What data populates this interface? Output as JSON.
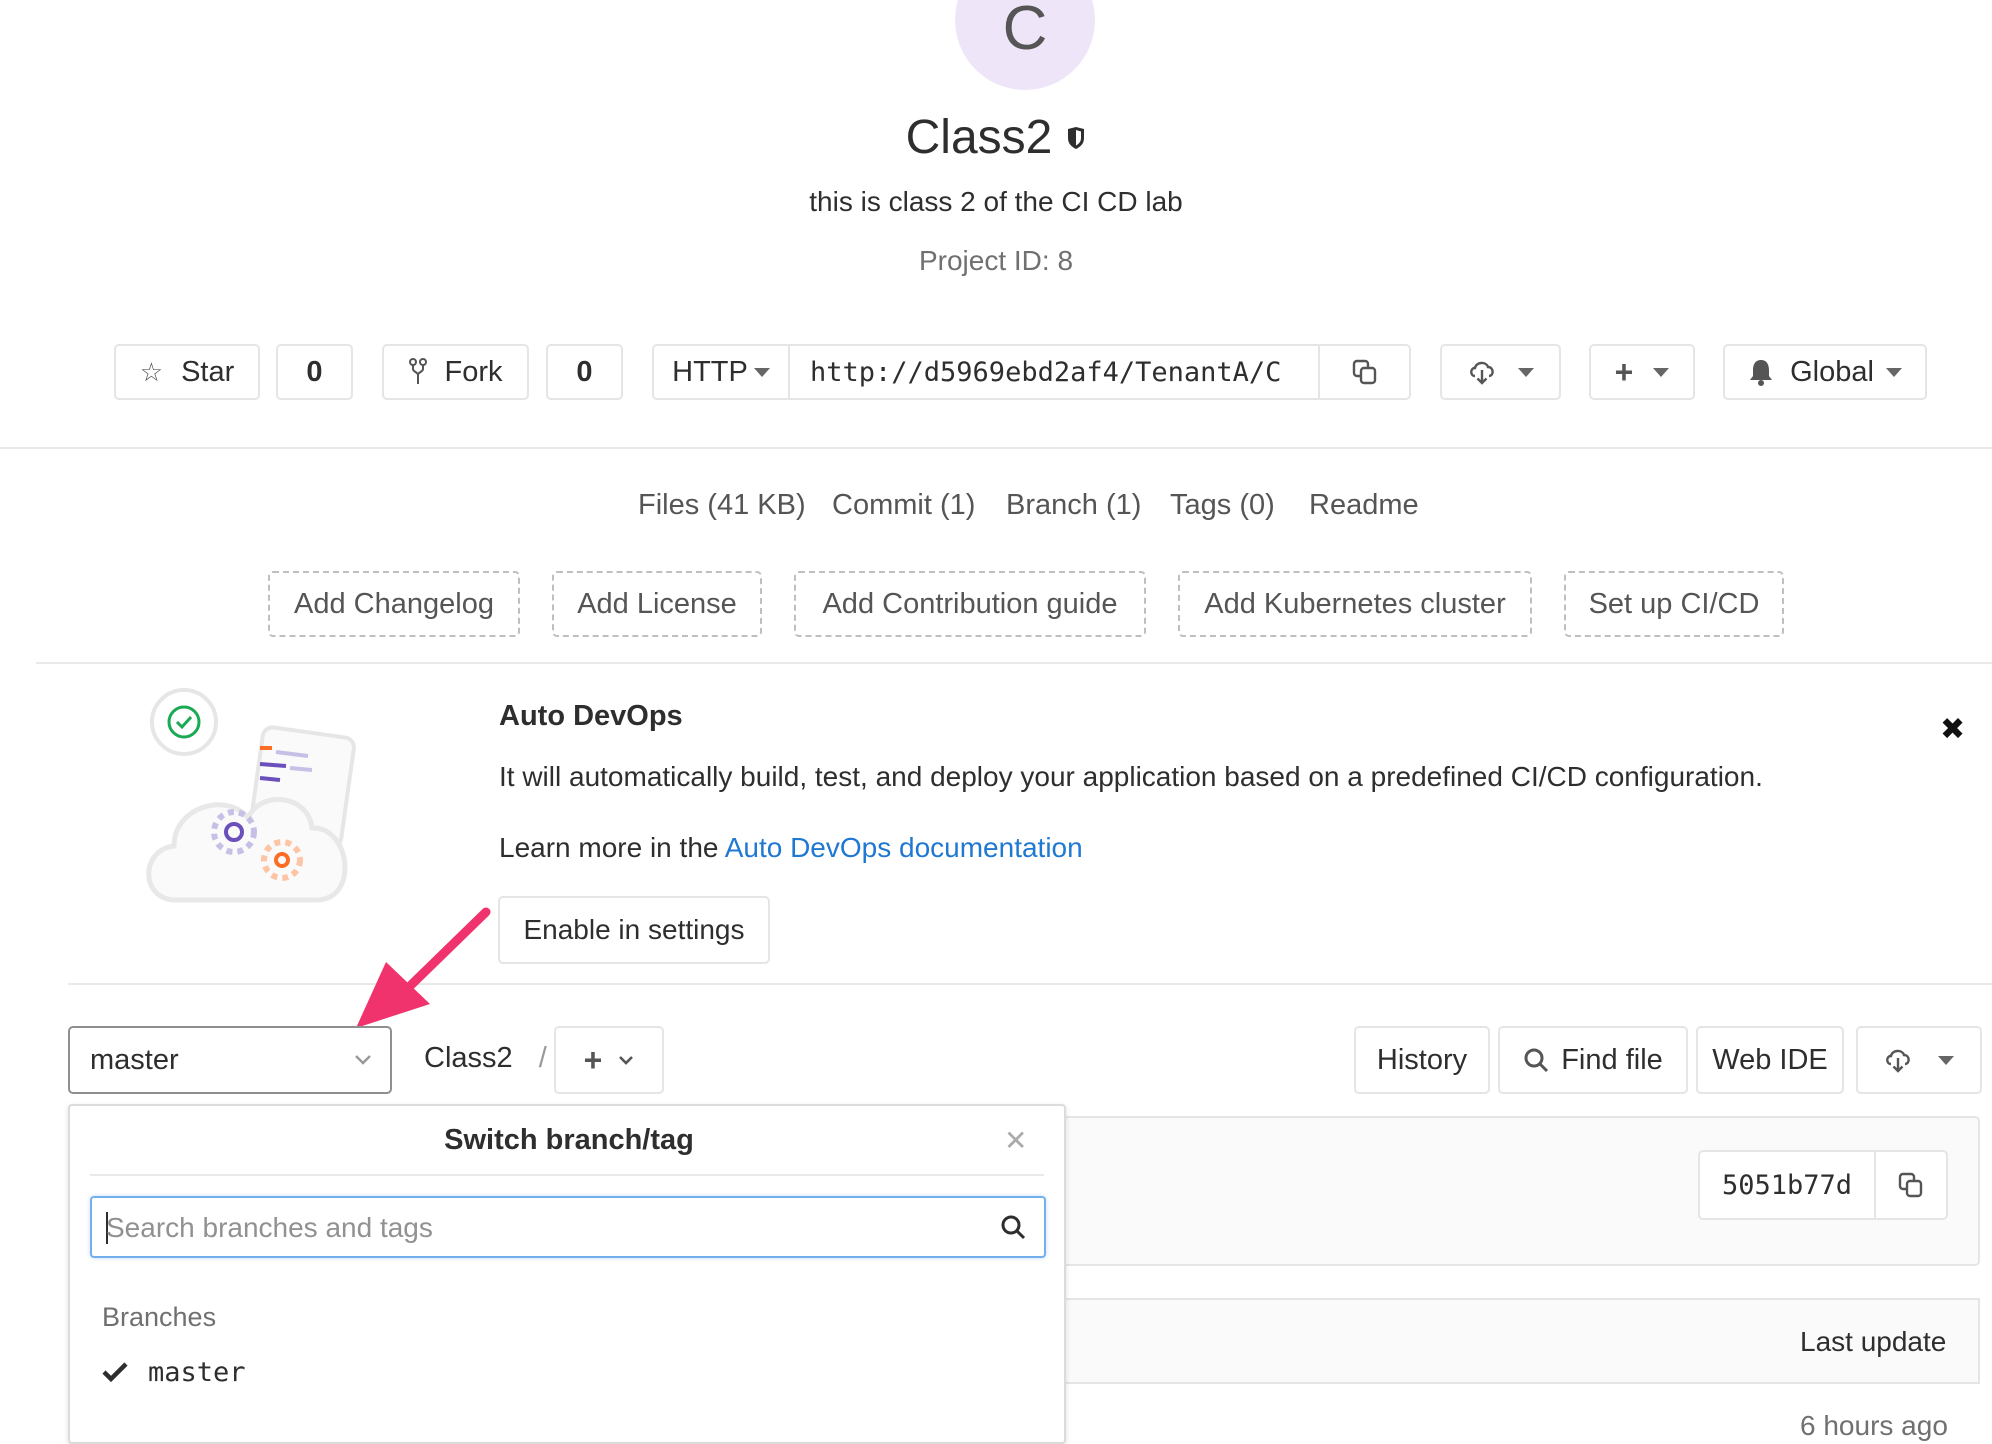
{
  "project": {
    "avatar_letter": "C",
    "name": "Class2",
    "description": "this is class 2 of the CI CD lab",
    "project_id": "Project ID: 8"
  },
  "actions": {
    "star_label": "Star",
    "star_count": "0",
    "fork_label": "Fork",
    "fork_count": "0",
    "protocol": "HTTP",
    "clone_url": "http://d5969ebd2af4/TenantA/C",
    "notification_label": "Global"
  },
  "stats": {
    "files": "Files (41 KB)",
    "commit": "Commit (1)",
    "branch": "Branch (1)",
    "tags": "Tags (0)",
    "readme": "Readme"
  },
  "quick_add": {
    "changelog": "Add Changelog",
    "license": "Add License",
    "contribution": "Add Contribution guide",
    "kubernetes": "Add Kubernetes cluster",
    "cicd": "Set up CI/CD"
  },
  "auto_devops": {
    "title": "Auto DevOps",
    "body": "It will automatically build, test, and deploy your application based on a predefined CI/CD configuration.",
    "learn_prefix": "Learn more in the",
    "learn_link": "Auto DevOps documentation",
    "enable_button": "Enable in settings"
  },
  "repo_bar": {
    "branch": "master",
    "path_root": "Class2",
    "separator": "/",
    "history": "History",
    "find_file": "Find file",
    "web_ide": "Web IDE"
  },
  "commit": {
    "sha": "5051b77d"
  },
  "table": {
    "last_update_header": "Last update",
    "first_row_update": "6 hours ago"
  },
  "branch_dropdown": {
    "title": "Switch branch/tag",
    "search_placeholder": "Search branches and tags",
    "section_label": "Branches",
    "items": [
      {
        "name": "master",
        "selected": true
      }
    ]
  },
  "colors": {
    "link": "#1f78d1",
    "annotation_arrow": "#f0336c",
    "avatar_bg": "#eee5f8",
    "focus_border": "#73afea"
  }
}
